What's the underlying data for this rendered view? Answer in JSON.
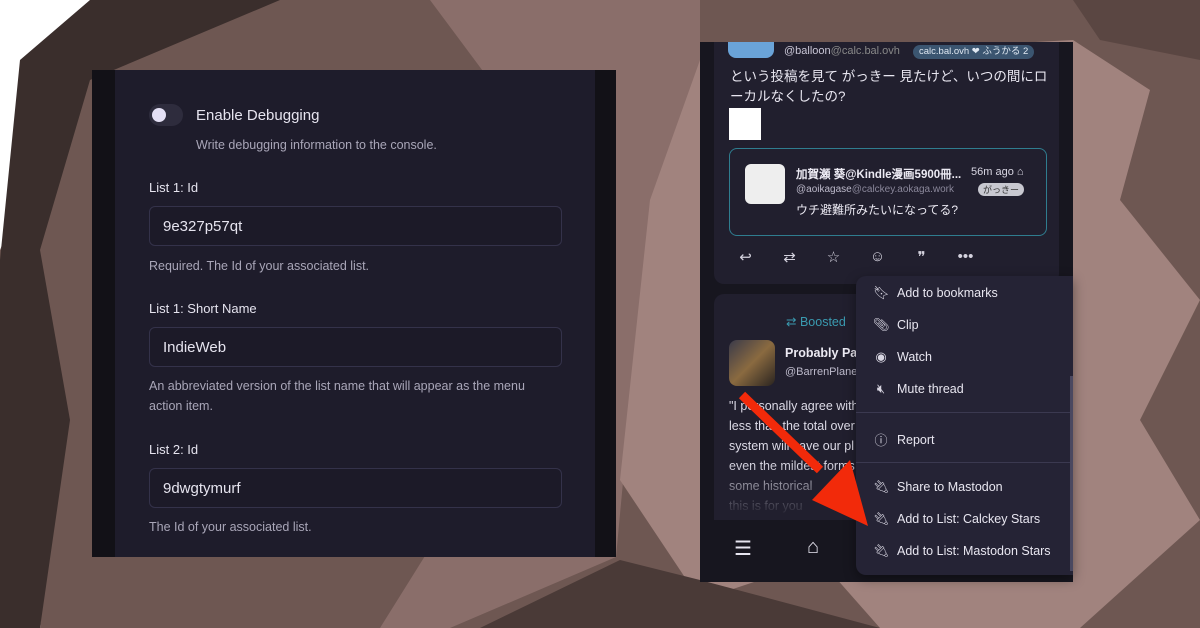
{
  "settings": {
    "toggle_label": "Enable Debugging",
    "toggle_desc": "Write debugging information to the console.",
    "toggle_on": false,
    "fields": [
      {
        "label": "List 1: Id",
        "value": "9e327p57qt",
        "help": "Required. The Id of your associated list."
      },
      {
        "label": "List 1: Short Name",
        "value": "IndieWeb",
        "help": "An abbreviated version of the list name that will appear as the menu action item."
      },
      {
        "label": "List 2: Id",
        "value": "9dwgtymurf",
        "help": "The Id of your associated list."
      }
    ]
  },
  "timeline": {
    "note1": {
      "handle": "@balloon",
      "host": "@calc.bal.ovh",
      "instance": "calc.bal.ovh ❤ ふうかる 2",
      "text": "という投稿を見て がっきー 見たけど、いつの間にローカルなくしたの?",
      "quote": {
        "name": "加賀瀬 葵@Kindle漫画5900冊...",
        "time": "56m ago",
        "handle": "@aoikagase",
        "host": "@calckey.aokaga.work",
        "badge": "がっきー",
        "text": "ウチ避難所みたいになってる?"
      }
    },
    "note2": {
      "boosted": "Boosted",
      "name": "Probably Pa",
      "handle": "@BarrenPlanet",
      "lines": [
        "\"I personally agree with",
        "less than the total over",
        "system will save our pl",
        "even the mildest forms",
        "some historical ",
        "this is for you"
      ]
    }
  },
  "menu": {
    "items": [
      {
        "label": "Add to bookmarks",
        "icon": "bookmark-icon"
      },
      {
        "label": "Clip",
        "icon": "paperclip-icon"
      },
      {
        "label": "Watch",
        "icon": "eye-icon"
      },
      {
        "label": "Mute thread",
        "icon": "mute-icon"
      },
      {
        "label": "Report",
        "icon": "alert-icon"
      },
      {
        "label": "Share to Mastodon",
        "icon": "plug-icon"
      },
      {
        "label": "Add to List: Calckey Stars",
        "icon": "plug-icon"
      },
      {
        "label": "Add to List: Mastodon Stars",
        "icon": "plug-icon"
      }
    ]
  },
  "colors": {
    "annotation_arrow": "#f22a0a",
    "accent": "#3a9ab0"
  }
}
